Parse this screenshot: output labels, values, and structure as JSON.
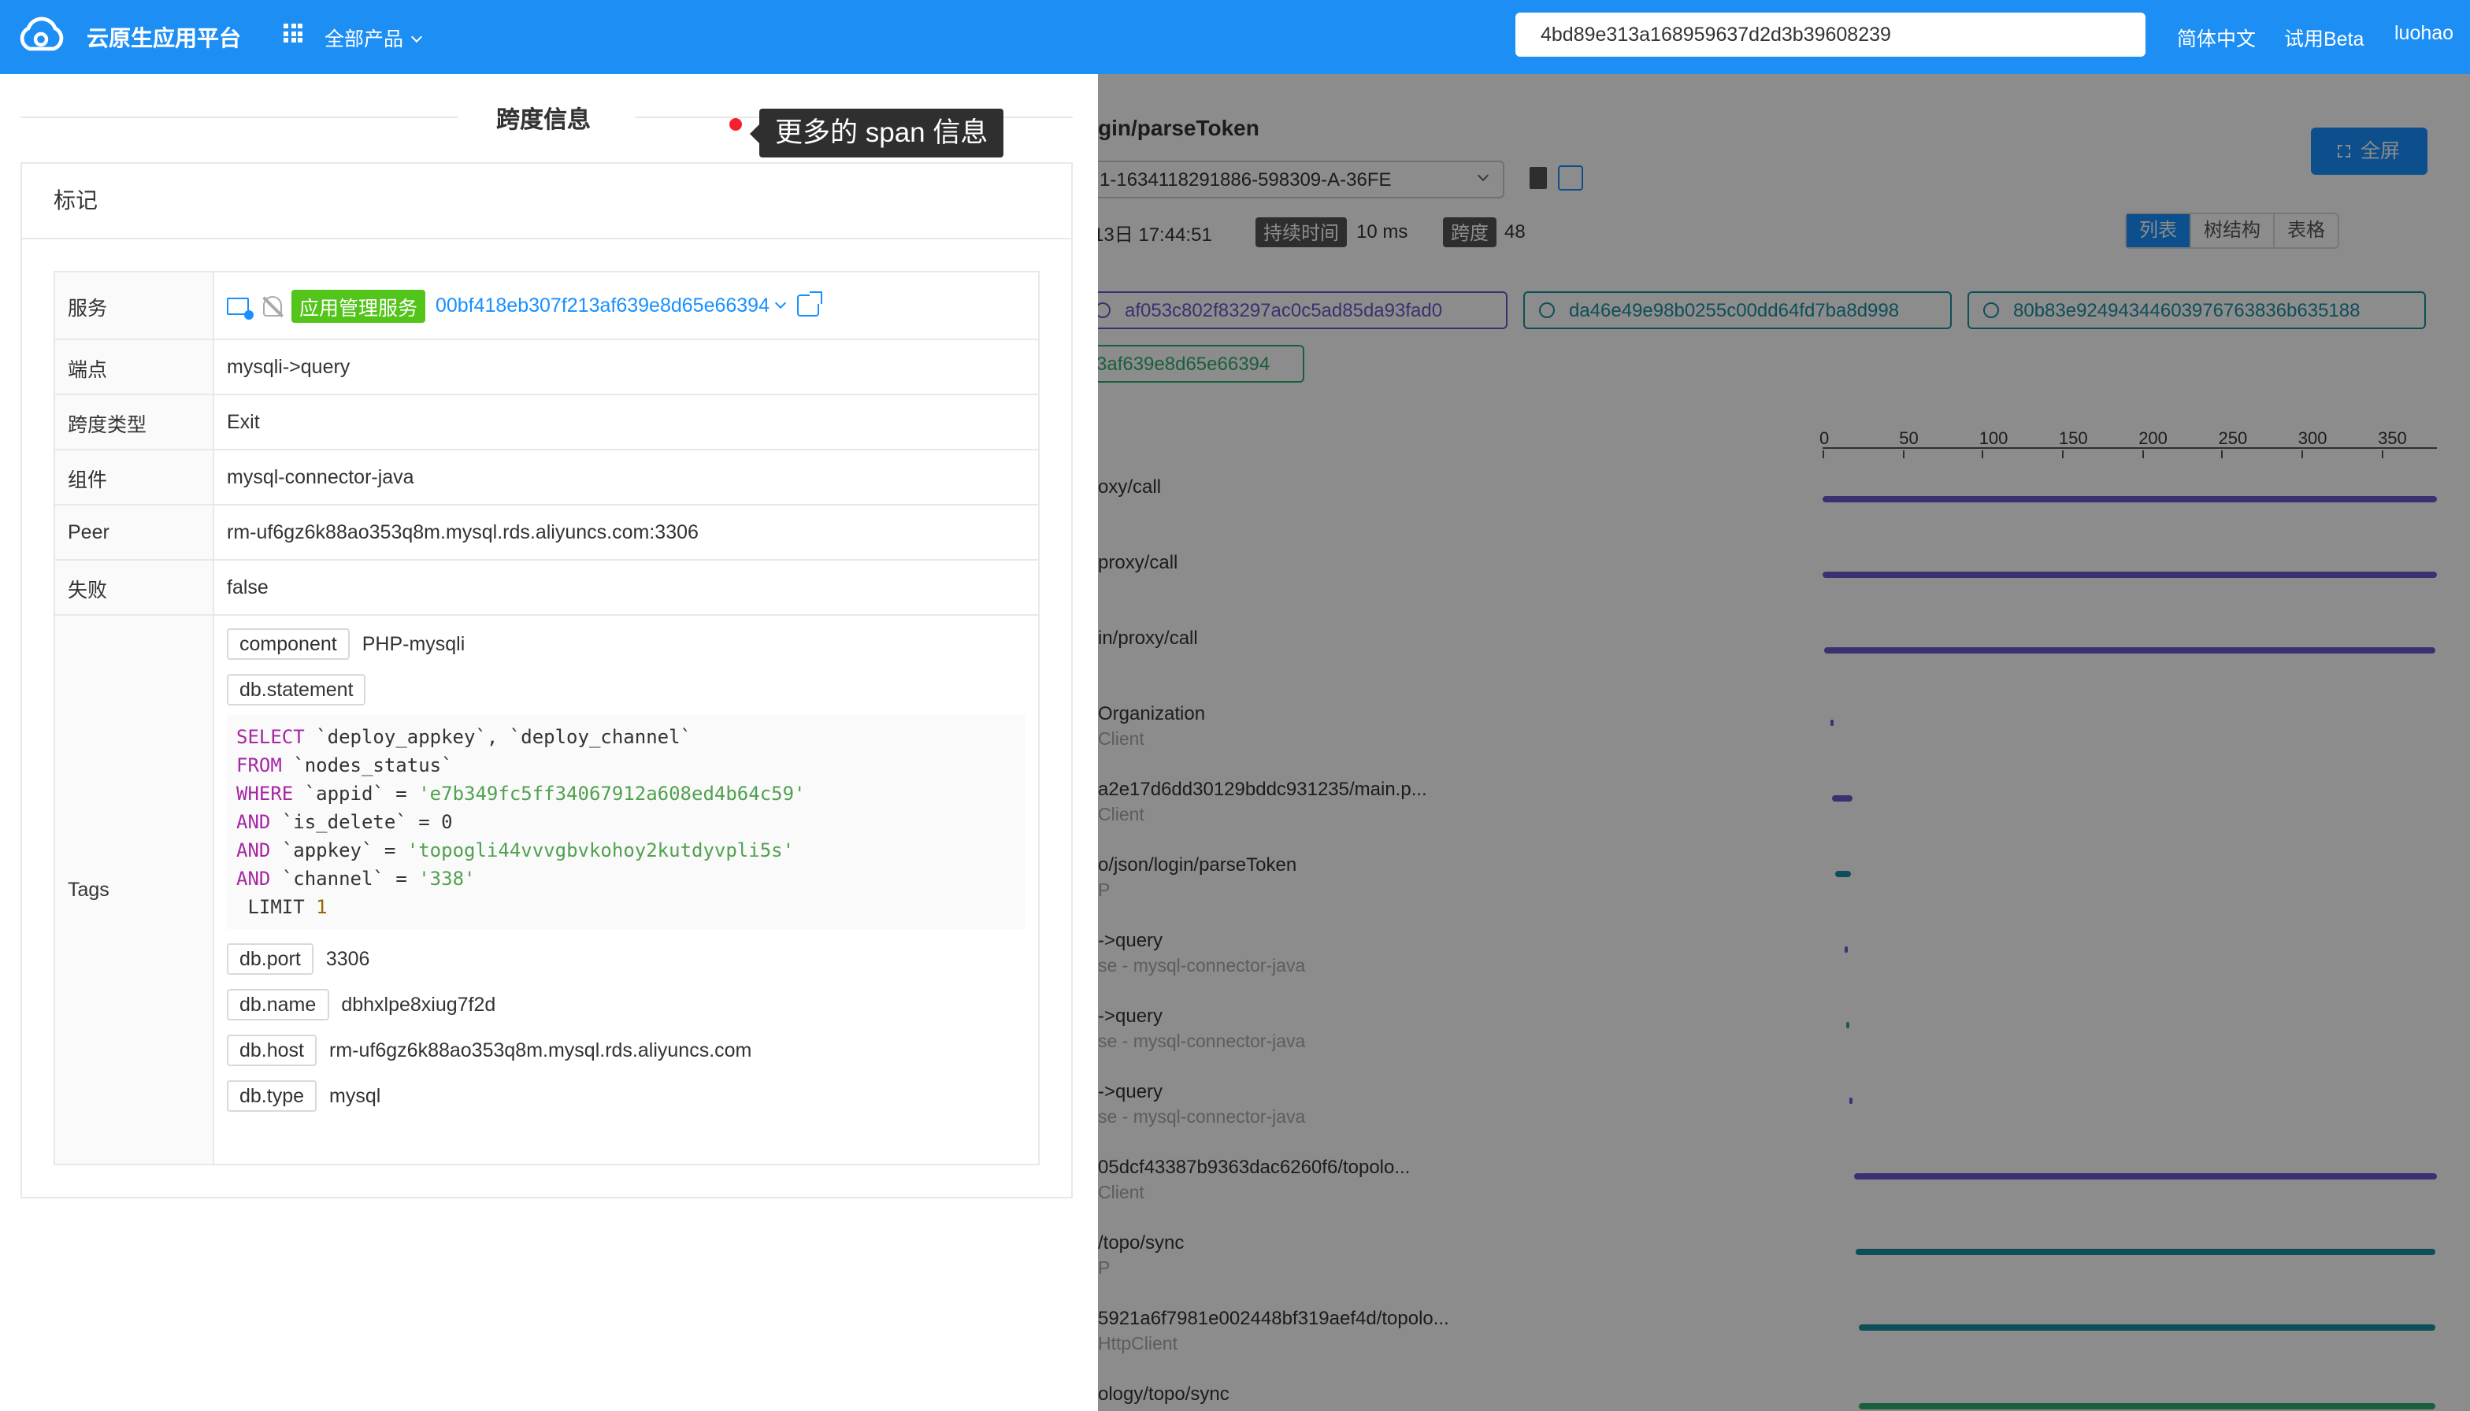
{
  "header": {
    "brand": "云原生应用平台",
    "all_products": "全部产品",
    "search_value": "4bd89e313a168959637d2d3b39608239",
    "language": "简体中文",
    "beta": "试用Beta",
    "user": "luohao"
  },
  "trace": {
    "endpoint_title": "gin/parseToken",
    "trace_id": "1-1634118291886-598309-A-36FE",
    "start_time": "13日 17:44:51",
    "duration_label": "持续时间",
    "duration": "10 ms",
    "span_label": "跨度",
    "span_count": "48",
    "fullscreen": "全屏",
    "views": [
      "列表",
      "树结构",
      "表格"
    ],
    "services": [
      {
        "id": "af053c802f83297ac0c5ad85da93fad0",
        "color": "#6a5acd"
      },
      {
        "id": "da46e49e98b0255c00dd64fd7ba8d998",
        "color": "#1890a0"
      },
      {
        "id": "80b83e92494344603976763836b635188",
        "color": "#1890a0"
      },
      {
        "id": "3af639e8d65e66394",
        "color": "#2eae6e"
      }
    ],
    "axis_ticks": [
      "0",
      "50",
      "100",
      "150",
      "200",
      "250",
      "300",
      "350"
    ],
    "axis_max": 385,
    "spans": [
      {
        "name": "oxy/call",
        "sub": "",
        "start": 0,
        "end": 385,
        "color": "#6a5acd"
      },
      {
        "name": "proxy/call",
        "sub": "",
        "start": 0,
        "end": 385,
        "color": "#6a5acd"
      },
      {
        "name": "in/proxy/call",
        "sub": "",
        "start": 1,
        "end": 384,
        "color": "#6a5acd"
      },
      {
        "name": "Organization",
        "sub": "Client",
        "start": 5,
        "end": 7,
        "color": "#6a5acd"
      },
      {
        "name": "a2e17d6dd30129bddc931235/main.p...",
        "sub": "Client",
        "start": 6,
        "end": 19,
        "color": "#6a5acd"
      },
      {
        "name": "o/json/login/parseToken",
        "sub": "P",
        "start": 8,
        "end": 18,
        "color": "#1890a0"
      },
      {
        "name": "->query",
        "sub": "se - mysql-connector-java",
        "start": 14,
        "end": 16,
        "color": "#6a5acd"
      },
      {
        "name": "->query",
        "sub": "se - mysql-connector-java",
        "start": 15,
        "end": 17,
        "color": "#2eae6e"
      },
      {
        "name": "->query",
        "sub": "se - mysql-connector-java",
        "start": 17,
        "end": 19,
        "color": "#6a5acd"
      },
      {
        "name": "05dcf43387b9363dac6260f6/topolo...",
        "sub": "Client",
        "start": 20,
        "end": 385,
        "color": "#6a5acd"
      },
      {
        "name": "/topo/sync",
        "sub": "P",
        "start": 21,
        "end": 384,
        "color": "#1890a0"
      },
      {
        "name": "5921a6f7981e002448bf319aef4d/topolo...",
        "sub": "HttpClient",
        "start": 23,
        "end": 384,
        "color": "#1890a0"
      },
      {
        "name": "ology/topo/sync",
        "sub": "",
        "start": 23,
        "end": 384,
        "color": "#2eae6e"
      }
    ]
  },
  "drawer": {
    "title": "跨度信息",
    "tooltip": "更多的 span 信息",
    "section": "标记",
    "service_label": "服务",
    "service_tag": "应用管理服务",
    "service_id": "00bf418eb307f213af639e8d65e66394",
    "rows": [
      {
        "key": "端点",
        "value": "mysqli->query"
      },
      {
        "key": "跨度类型",
        "value": "Exit"
      },
      {
        "key": "组件",
        "value": "mysql-connector-java"
      },
      {
        "key": "Peer",
        "value": "rm-uf6gz6k88ao353q8m.mysql.rds.aliyuncs.com:3306"
      },
      {
        "key": "失败",
        "value": "false"
      }
    ],
    "tags_label": "Tags",
    "tags": {
      "component_key": "component",
      "component_val": "PHP-mysqli",
      "statement_key": "db.statement",
      "sql": {
        "l1a": "SELECT",
        "l1b": " `deploy_appkey`, `deploy_channel`",
        "l2a": "FROM",
        "l2b": " `nodes_status`",
        "l3a": "WHERE",
        "l3b": " `appid` = ",
        "l3c": "'e7b349fc5ff34067912a608ed4b64c59'",
        "l4a": "AND",
        "l4b": " `is_delete` = 0",
        "l5a": "AND",
        "l5b": " `appkey` = ",
        "l5c": "'topogli44vvvgbvkohoy2kutdyvpli5s'",
        "l6a": "AND",
        "l6b": " `channel` = ",
        "l6c": "'338'",
        "l7a": " LIMIT ",
        "l7b": "1"
      },
      "port_key": "db.port",
      "port_val": "3306",
      "name_key": "db.name",
      "name_val": "dbhxlpe8xiug7f2d",
      "host_key": "db.host",
      "host_val": "rm-uf6gz6k88ao353q8m.mysql.rds.aliyuncs.com",
      "type_key": "db.type",
      "type_val": "mysql"
    }
  }
}
